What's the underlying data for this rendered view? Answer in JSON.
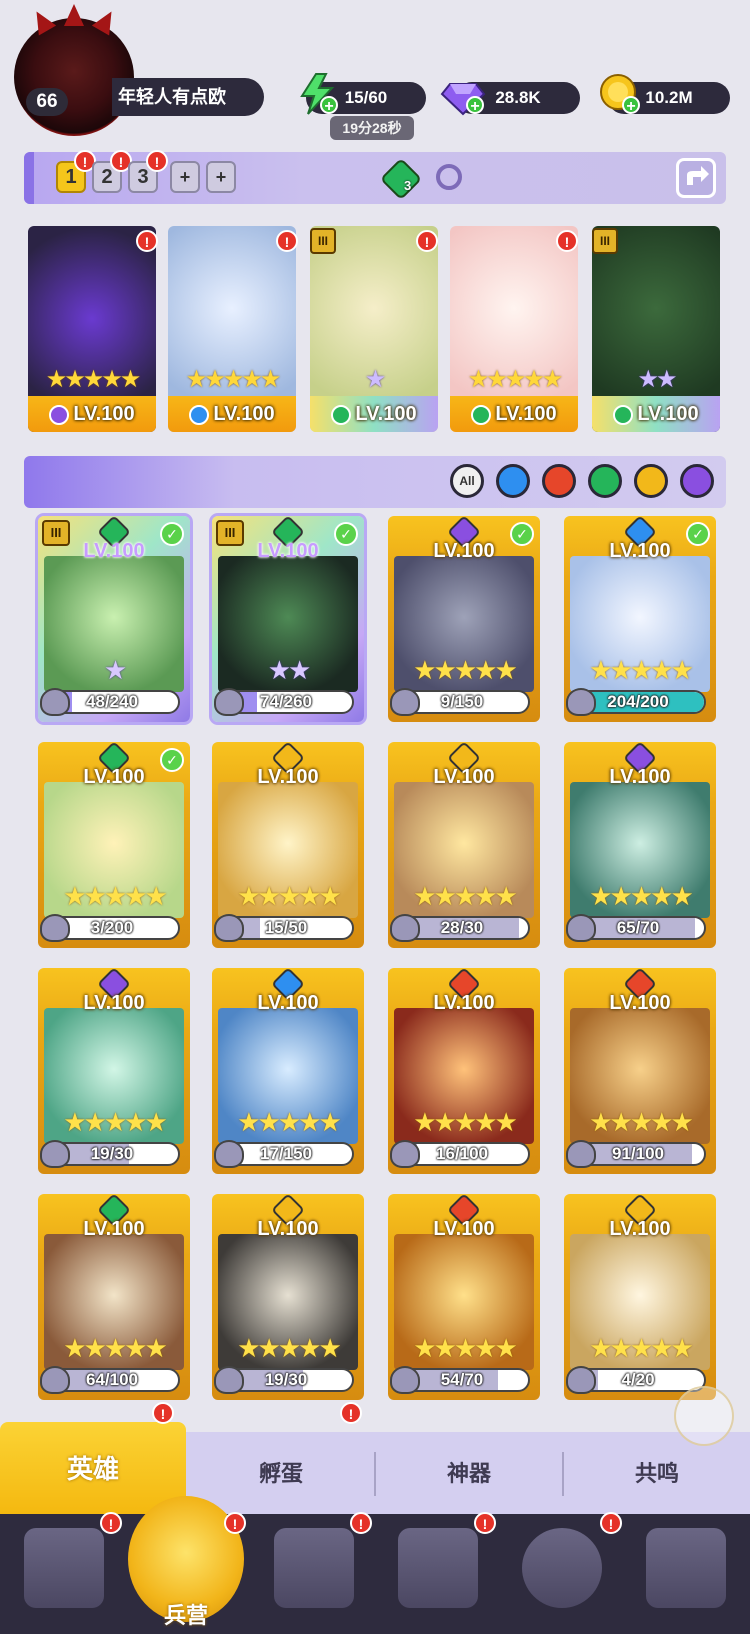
{
  "player": {
    "level": "66",
    "name": "年轻人有点欧"
  },
  "resources": {
    "energy": "15/60",
    "energy_timer": "19分28秒",
    "gems": "28.8K",
    "gold": "10.2M"
  },
  "team_tabs": [
    "1",
    "2",
    "3",
    "+",
    "+"
  ],
  "team_count": "3",
  "team_heroes": [
    {
      "level": "LV.100",
      "stars": "★★★★★",
      "element": "dark"
    },
    {
      "level": "LV.100",
      "stars": "★★★★★",
      "element": "water"
    },
    {
      "level": "LV.100",
      "stars": "★",
      "element": "wind",
      "rank": "III"
    },
    {
      "level": "LV.100",
      "stars": "★★★★★",
      "element": "wind"
    },
    {
      "level": "LV.100",
      "stars": "★★",
      "element": "wind",
      "rank": "III"
    }
  ],
  "filters": [
    "All",
    "water",
    "fire",
    "wind",
    "light",
    "dark"
  ],
  "heroes": [
    {
      "level": "LV.100",
      "progress": "48/240",
      "fraction": 0.2,
      "element": "wind",
      "checked": true,
      "rank": "III",
      "stars": "★",
      "level_style": "purple"
    },
    {
      "level": "LV.100",
      "progress": "74/260",
      "fraction": 0.28,
      "element": "wind",
      "checked": true,
      "rank": "III",
      "stars": "★★",
      "level_style": "purple"
    },
    {
      "level": "LV.100",
      "progress": "9/150",
      "fraction": 0.06,
      "element": "dark",
      "checked": true,
      "stars": "★★★★★"
    },
    {
      "level": "LV.100",
      "progress": "204/200",
      "fraction": 1.0,
      "element": "water",
      "checked": true,
      "stars": "★★★★★"
    },
    {
      "level": "LV.100",
      "progress": "3/200",
      "fraction": 0.015,
      "element": "wind",
      "checked": true,
      "stars": "★★★★★"
    },
    {
      "level": "LV.100",
      "progress": "15/50",
      "fraction": 0.3,
      "element": "light",
      "stars": "★★★★★"
    },
    {
      "level": "LV.100",
      "progress": "28/30",
      "fraction": 0.93,
      "element": "light",
      "stars": "★★★★★"
    },
    {
      "level": "LV.100",
      "progress": "65/70",
      "fraction": 0.93,
      "element": "dark",
      "stars": "★★★★★"
    },
    {
      "level": "LV.100",
      "progress": "19/30",
      "fraction": 0.63,
      "element": "dark",
      "stars": "★★★★★"
    },
    {
      "level": "LV.100",
      "progress": "17/150",
      "fraction": 0.11,
      "element": "water",
      "stars": "★★★★★"
    },
    {
      "level": "LV.100",
      "progress": "16/100",
      "fraction": 0.16,
      "element": "fire",
      "stars": "★★★★★"
    },
    {
      "level": "LV.100",
      "progress": "91/100",
      "fraction": 0.91,
      "element": "fire",
      "stars": "★★★★★"
    },
    {
      "level": "LV.100",
      "progress": "64/100",
      "fraction": 0.64,
      "element": "wind",
      "stars": "★★★★★"
    },
    {
      "level": "LV.100",
      "progress": "19/30",
      "fraction": 0.63,
      "element": "light",
      "stars": "★★★★★"
    },
    {
      "level": "LV.100",
      "progress": "54/70",
      "fraction": 0.77,
      "element": "fire",
      "stars": "★★★★★"
    },
    {
      "level": "LV.100",
      "progress": "4/20",
      "fraction": 0.2,
      "element": "light",
      "stars": "★★★★★"
    }
  ],
  "sub_tabs": [
    "英雄",
    "孵蛋",
    "神器",
    "共鸣"
  ],
  "nav": {
    "barracks": "兵营"
  },
  "colors": {
    "water": "#2e8ff0",
    "fire": "#e6462a",
    "wind": "#25b55a",
    "light": "#f2b81a",
    "dark": "#8a4fe0",
    "accent": "#f5c61b"
  }
}
